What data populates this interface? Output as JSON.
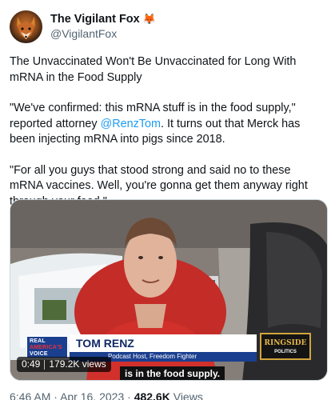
{
  "author": {
    "display_name": "The Vigilant Fox",
    "emoji": "🦊",
    "handle": "@VigilantFox",
    "avatar_icon": "fox-avatar"
  },
  "tweet": {
    "paragraph_1": "The Unvaccinated Won't Be Unvaccinated for Long With mRNA in the Food Supply",
    "paragraph_2_before": "\"We've confirmed: this mRNA stuff is in the food supply,\" reported attorney ",
    "paragraph_2_mention": "@RenzTom",
    "paragraph_2_after": ". It turns out that Merck has been injecting mRNA into pigs since 2018.",
    "paragraph_3": "\"For all you guys that stood strong and said no to these mRNA vaccines. Well, you're gonna get them anyway right through your food.\""
  },
  "video": {
    "channel_logo_line1": "REAL",
    "channel_logo_line2": "AMERICA'S",
    "channel_logo_line3": "VOICE",
    "lower_third_name": "TOM RENZ",
    "lower_third_title": "Podcast Host, Freedom Fighter",
    "partner_logo_line1": "RINGSIDE",
    "partner_logo_line2": "POLITICS",
    "caption": "is in the food supply.",
    "duration": "0:49",
    "views": "179.2K views"
  },
  "meta": {
    "time": "6:46 AM",
    "dot": "·",
    "date": "Apr 16, 2023",
    "views_count": "482.6K",
    "views_label": "Views"
  },
  "colors": {
    "link": "#1d9bf0",
    "secondary_text": "#536471",
    "primary_text": "#0f1419"
  }
}
